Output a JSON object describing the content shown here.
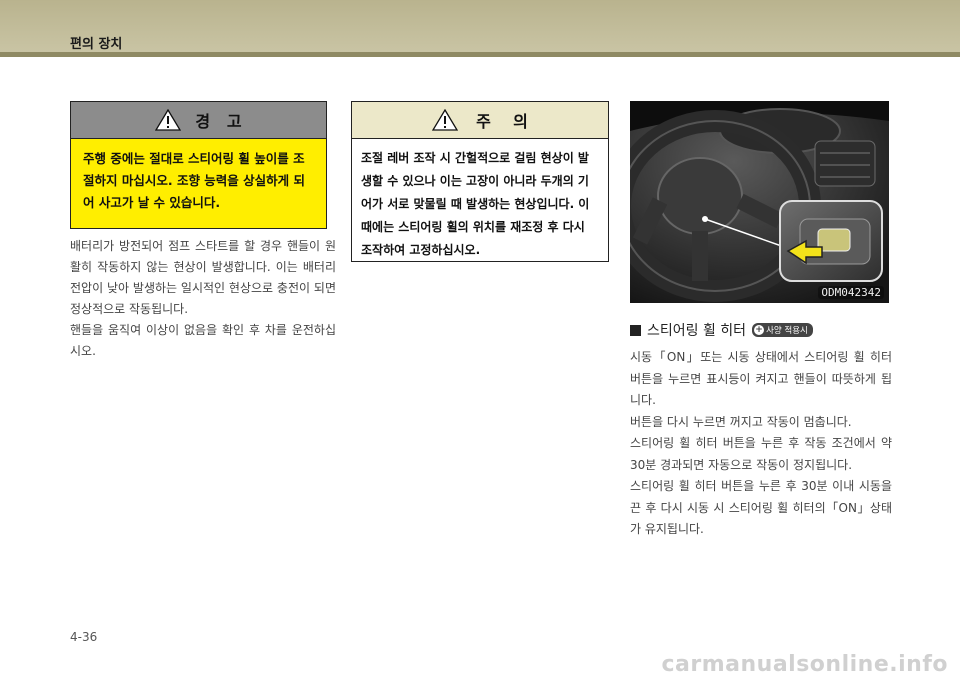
{
  "header": {
    "section_title": "편의 장치"
  },
  "warning": {
    "title": "경   고",
    "text": "주행 중에는 절대로 스티어링 휠 높이를 조절하지 마십시오. 조향 능력을 상실하게 되어 사고가 날 수 있습니다."
  },
  "left_body": [
    "배터리가 방전되어 점프 스타트를 할 경우 핸들이 원활히 작동하지 않는 현상이 발생합니다. 이는 배터리 전압이 낮아 발생하는 일시적인 현상으로 충전이 되면 정상적으로 작동됩니다.",
    "핸들을 움직여 이상이 없음을 확인 후 차를 운전하십시오."
  ],
  "caution": {
    "title": "주    의",
    "text": "조절 레버 조작 시 간헐적으로 걸림 현상이 발생할 수 있으나 이는 고장이 아니라 두개의 기어가 서로 맞물릴 때 발생하는 현상입니다. 이때에는 스티어링 휠의 위치를 재조정 후 다시 조작하여 고정하십시오."
  },
  "photo": {
    "code": "ODM042342"
  },
  "right_section": {
    "title": "스티어링 휠 히터",
    "badge": "사양 적용시",
    "paragraphs": [
      "시동「ON」또는 시동 상태에서 스티어링 휠 히터 버튼을 누르면 표시등이 켜지고 핸들이 따뜻하게 됩니다.",
      "버튼을 다시 누르면 꺼지고 작동이 멈춥니다.",
      "스티어링 휠 히터 버튼을 누른 후 작동 조건에서 약 30분 경과되면 자동으로 작동이 정지됩니다.",
      "스티어링 휠 히터 버튼을 누른 후 30분 이내 시동을 끈 후 다시 시동 시 스티어링 휠 히터의「ON」상태가 유지됩니다."
    ]
  },
  "page_number": "4-36",
  "watermark": "carmanualsonline.info",
  "colors": {
    "header": "#c9c4a4",
    "warning_bg": "#ffee00",
    "warning_head": "#8c8c8c",
    "caution_head": "#ece8c9"
  }
}
